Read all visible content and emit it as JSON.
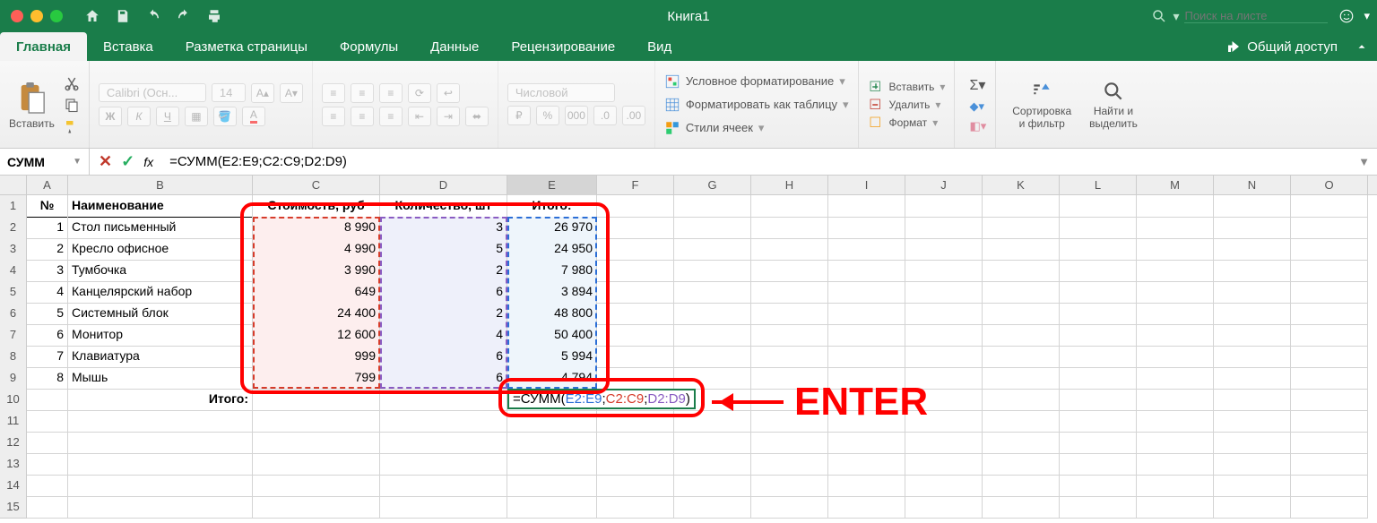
{
  "window": {
    "title": "Книга1"
  },
  "search": {
    "placeholder": "Поиск на листе"
  },
  "tabs": {
    "home": "Главная",
    "insert": "Вставка",
    "layout": "Разметка страницы",
    "formulas": "Формулы",
    "data": "Данные",
    "review": "Рецензирование",
    "view": "Вид",
    "share": "Общий доступ"
  },
  "ribbon": {
    "paste": "Вставить",
    "font_name": "Calibri (Осн...",
    "font_size": "14",
    "number_format": "Числовой",
    "cond_fmt": "Условное форматирование",
    "as_table": "Форматировать как таблицу",
    "cell_styles": "Стили ячеек",
    "insert_cells": "Вставить",
    "delete_cells": "Удалить",
    "format_cells": "Формат",
    "sort": "Сортировка\nи фильтр",
    "find": "Найти и\nвыделить"
  },
  "namebox": "СУММ",
  "formula_bar": "=СУММ(E2:E9;C2:C9;D2:D9)",
  "columns": [
    "A",
    "B",
    "C",
    "D",
    "E",
    "F",
    "G",
    "H",
    "I",
    "J",
    "K",
    "L",
    "M",
    "N",
    "O"
  ],
  "head": {
    "no": "№",
    "name": "Наименование",
    "cost": "Стоимость, руб",
    "qty": "Количество, шт",
    "total": "Итого:"
  },
  "data_rows": [
    {
      "n": "1",
      "name": "Стол письменный",
      "cost": "8 990",
      "qty": "3",
      "total": "26 970"
    },
    {
      "n": "2",
      "name": "Кресло офисное",
      "cost": "4 990",
      "qty": "5",
      "total": "24 950"
    },
    {
      "n": "3",
      "name": "Тумбочка",
      "cost": "3 990",
      "qty": "2",
      "total": "7 980"
    },
    {
      "n": "4",
      "name": "Канцелярский набор",
      "cost": "649",
      "qty": "6",
      "total": "3 894"
    },
    {
      "n": "5",
      "name": "Системный блок",
      "cost": "24 400",
      "qty": "2",
      "total": "48 800"
    },
    {
      "n": "6",
      "name": "Монитор",
      "cost": "12 600",
      "qty": "4",
      "total": "50 400"
    },
    {
      "n": "7",
      "name": "Клавиатура",
      "cost": "999",
      "qty": "6",
      "total": "5 994"
    },
    {
      "n": "8",
      "name": "Мышь",
      "cost": "799",
      "qty": "6",
      "total": "4 794"
    }
  ],
  "footer_label": "Итого:",
  "active_formula": {
    "pre": "=СУММ(",
    "r1": "E2:E9",
    "sep1": ";",
    "r2": "C2:C9",
    "sep2": ";",
    "r3": "D2:D9",
    "post": ")"
  },
  "annotation": "ENTER"
}
